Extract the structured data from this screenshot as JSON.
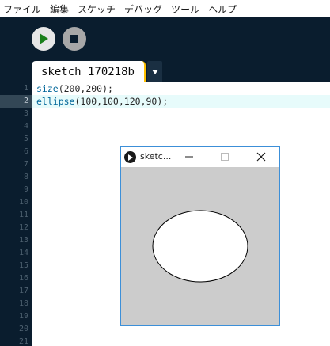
{
  "menubar": {
    "items": [
      "ファイル",
      "編集",
      "スケッチ",
      "デバッグ",
      "ツール",
      "ヘルプ"
    ]
  },
  "toolbar": {
    "run_icon": "play-icon",
    "stop_icon": "stop-icon"
  },
  "tabs": [
    {
      "label": "sketch_170218b"
    }
  ],
  "tab_menu_icon": "dropdown-arrow-icon",
  "editor": {
    "line_numbers": [
      "1",
      "2",
      "3",
      "4",
      "5",
      "6",
      "7",
      "8",
      "9",
      "10",
      "11",
      "12",
      "13",
      "14",
      "15",
      "16",
      "17",
      "18",
      "19",
      "20",
      "21"
    ],
    "current_line": 2,
    "code_lines": [
      {
        "fn": "size",
        "args": "(200,200);"
      },
      {
        "fn": "ellipse",
        "args": "(100,100,120,90);"
      }
    ],
    "keyword_color": "#006699"
  },
  "sketch_window": {
    "title": "sketc...",
    "app_icon": "processing-play-icon",
    "minimize_icon": "minimize-icon",
    "maximize_icon": "maximize-icon",
    "close_icon": "close-icon",
    "canvas_background": "#cccccc"
  },
  "colors": {
    "toolbar_bg": "#0a1d2e",
    "tab_accent": "#ffc000",
    "window_border": "#3c8fd8"
  }
}
